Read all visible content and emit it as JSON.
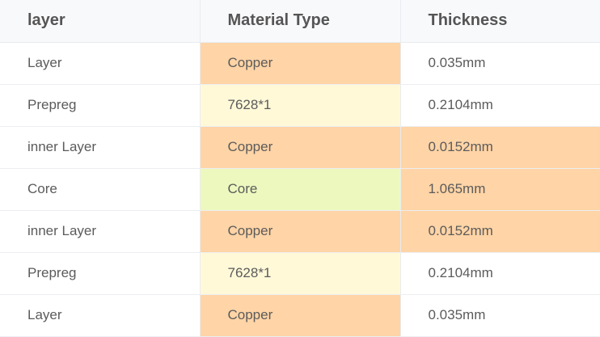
{
  "table": {
    "headers": [
      "layer",
      "Material Type",
      "Thickness"
    ],
    "rows": [
      {
        "layer": "Layer",
        "material": "Copper",
        "thickness": "0.035mm"
      },
      {
        "layer": "Prepreg",
        "material": "7628*1",
        "thickness": "0.2104mm"
      },
      {
        "layer": "inner Layer",
        "material": "Copper",
        "thickness": "0.0152mm"
      },
      {
        "layer": "Core",
        "material": "Core",
        "thickness": "1.065mm"
      },
      {
        "layer": "inner Layer",
        "material": "Copper",
        "thickness": "0.0152mm"
      },
      {
        "layer": "Prepreg",
        "material": "7628*1",
        "thickness": "0.2104mm"
      },
      {
        "layer": "Layer",
        "material": "Copper",
        "thickness": "0.035mm"
      }
    ]
  },
  "colors": {
    "copper_fill": "#ffd4a6",
    "prepreg_fill": "#fff9d8",
    "core_fill": "#edf8bf",
    "header_fill": "#f8f9fb"
  }
}
